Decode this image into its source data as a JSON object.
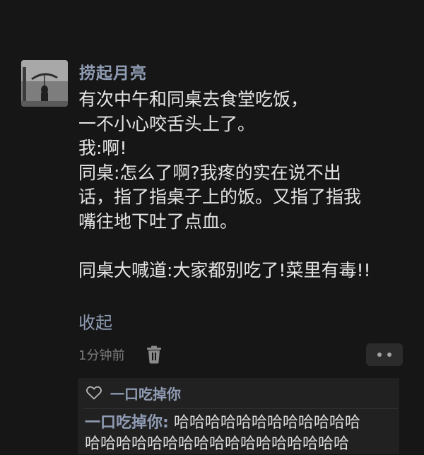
{
  "post": {
    "username": "捞起月亮",
    "lines": [
      "有次中午和同桌去食堂吃饭，",
      "一不小心咬舌头上了。",
      "我:啊!",
      "同桌:怎么了啊?我疼的实在说不出",
      "话，指了指桌子上的饭。又指了指我",
      "嘴往地下吐了点血。",
      "",
      "同桌大喊道:大家都别吃了!菜里有毒!!"
    ],
    "collapse_label": "收起",
    "timestamp": "1分钟前"
  },
  "icons": {
    "delete": "trash-icon",
    "more": "more-dots-icon",
    "like": "heart-outline-icon"
  },
  "reply_section": {
    "like_user": "一口吃掉你",
    "reply_author": "一口吃掉你:",
    "reply_line1_text": "哈哈哈哈哈哈哈哈哈哈哈哈",
    "reply_line2_text": "哈哈哈哈哈哈哈哈哈哈哈哈哈哈哈哈哈"
  },
  "colors": {
    "background": "#161616",
    "link": "#8f9cb4",
    "text": "#e4e4e4",
    "muted": "#7c7c7c",
    "panel": "#212121"
  }
}
